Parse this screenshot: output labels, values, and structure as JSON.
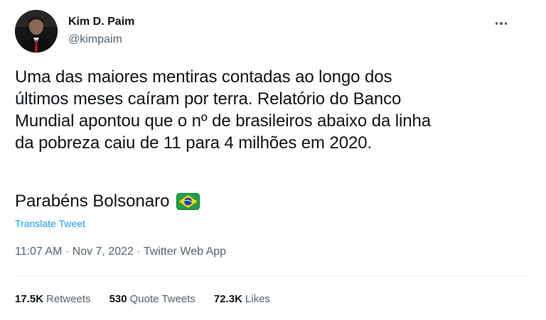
{
  "author": {
    "name": "Kim D. Paim",
    "handle": "@kimpaim"
  },
  "tweet": {
    "text": "Uma das maiores mentiras contadas ao longo dos\núltimos meses caíram por terra. Relatório do Banco\nMundial apontou que o nº de brasileiros abaixo da linha\nda pobreza caiu de 11 para 4 milhões em 2020.",
    "sign_off": "Parabéns Bolsonaro",
    "flag_icon": "brazil-flag-emoji",
    "translate_label": "Translate Tweet",
    "meta": "11:07 AM · Nov 7, 2022 · Twitter Web App"
  },
  "stats": {
    "retweets_count": "17.5K",
    "retweets_label": "Retweets",
    "quotes_count": "530",
    "quotes_label": "Quote Tweets",
    "likes_count": "72.3K",
    "likes_label": "Likes"
  },
  "colors": {
    "link": "#1d9bf0",
    "secondary_text": "#536471",
    "primary_text": "#0f1419"
  }
}
